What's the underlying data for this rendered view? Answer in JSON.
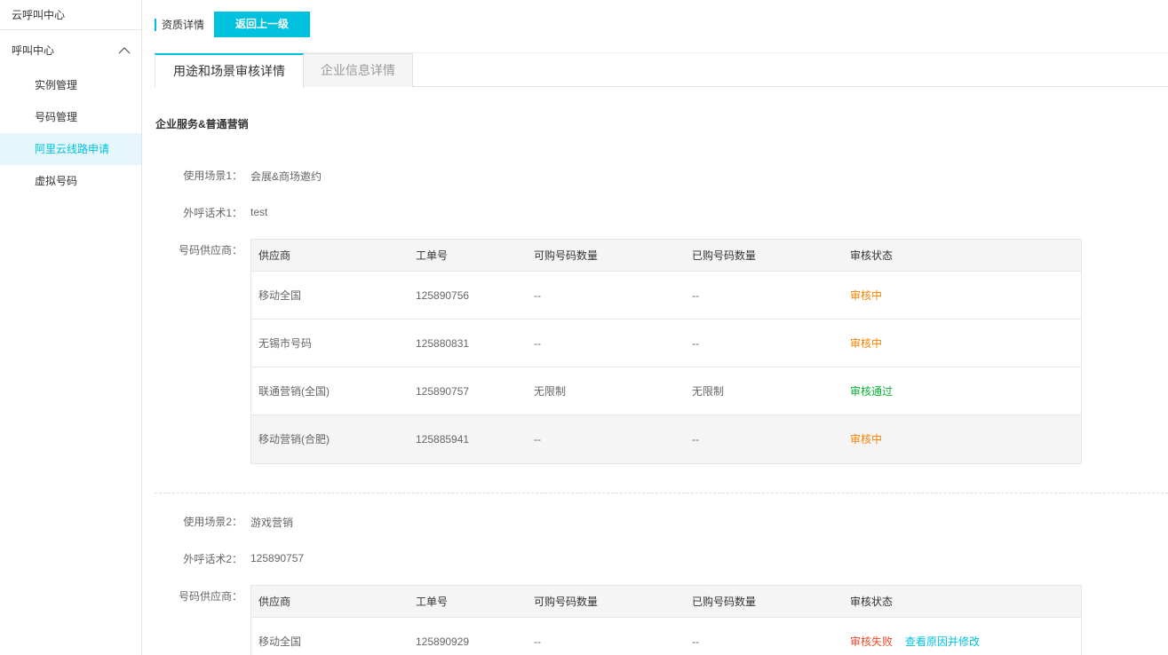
{
  "sidebar": {
    "title": "云呼叫中心",
    "group": "呼叫中心",
    "items": [
      {
        "label": "实例管理",
        "active": false
      },
      {
        "label": "号码管理",
        "active": false
      },
      {
        "label": "阿里云线路申请",
        "active": true
      },
      {
        "label": "虚拟号码",
        "active": false
      }
    ]
  },
  "header": {
    "title": "资质详情",
    "back_label": "返回上一级"
  },
  "tabs": [
    {
      "label": "用途和场景审核详情",
      "active": true
    },
    {
      "label": "企业信息详情",
      "active": false
    }
  ],
  "section_title": "企业服务&普通营销",
  "table_columns": [
    "供应商",
    "工单号",
    "可购号码数量",
    "已购号码数量",
    "审核状态"
  ],
  "scenarios": [
    {
      "scene_label": "使用场景1：",
      "scene_value": "会展&商场邀约",
      "script_label": "外呼话术1：",
      "script_value": "test",
      "supplier_label": "号码供应商：",
      "rows": [
        {
          "supplier": "移动全国",
          "ticket": "125890756",
          "available": "--",
          "purchased": "--",
          "status": "审核中",
          "status_color": "#f68300"
        },
        {
          "supplier": "无锡市号码",
          "ticket": "125880831",
          "available": "--",
          "purchased": "--",
          "status": "审核中",
          "status_color": "#f68300"
        },
        {
          "supplier": "联通营销(全国)",
          "ticket": "125890757",
          "available": "无限制",
          "purchased": "无限制",
          "status": "审核通过",
          "status_color": "#06b035"
        },
        {
          "supplier": "移动营销(合肥)",
          "ticket": "125885941",
          "available": "--",
          "purchased": "--",
          "status": "审核中",
          "status_color": "#f68300"
        }
      ]
    },
    {
      "scene_label": "使用场景2：",
      "scene_value": "游戏营销",
      "script_label": "外呼话术2：",
      "script_value": "125890757",
      "supplier_label": "号码供应商：",
      "rows": [
        {
          "supplier": "移动全国",
          "ticket": "125890929",
          "available": "--",
          "purchased": "--",
          "status": "审核失败",
          "status_color": "#e84a2c",
          "action": "查看原因并修改"
        }
      ]
    }
  ],
  "colors": {
    "accent": "#00c1de",
    "pending": "#f68300",
    "passed": "#06b035",
    "failed": "#e84a2c"
  }
}
